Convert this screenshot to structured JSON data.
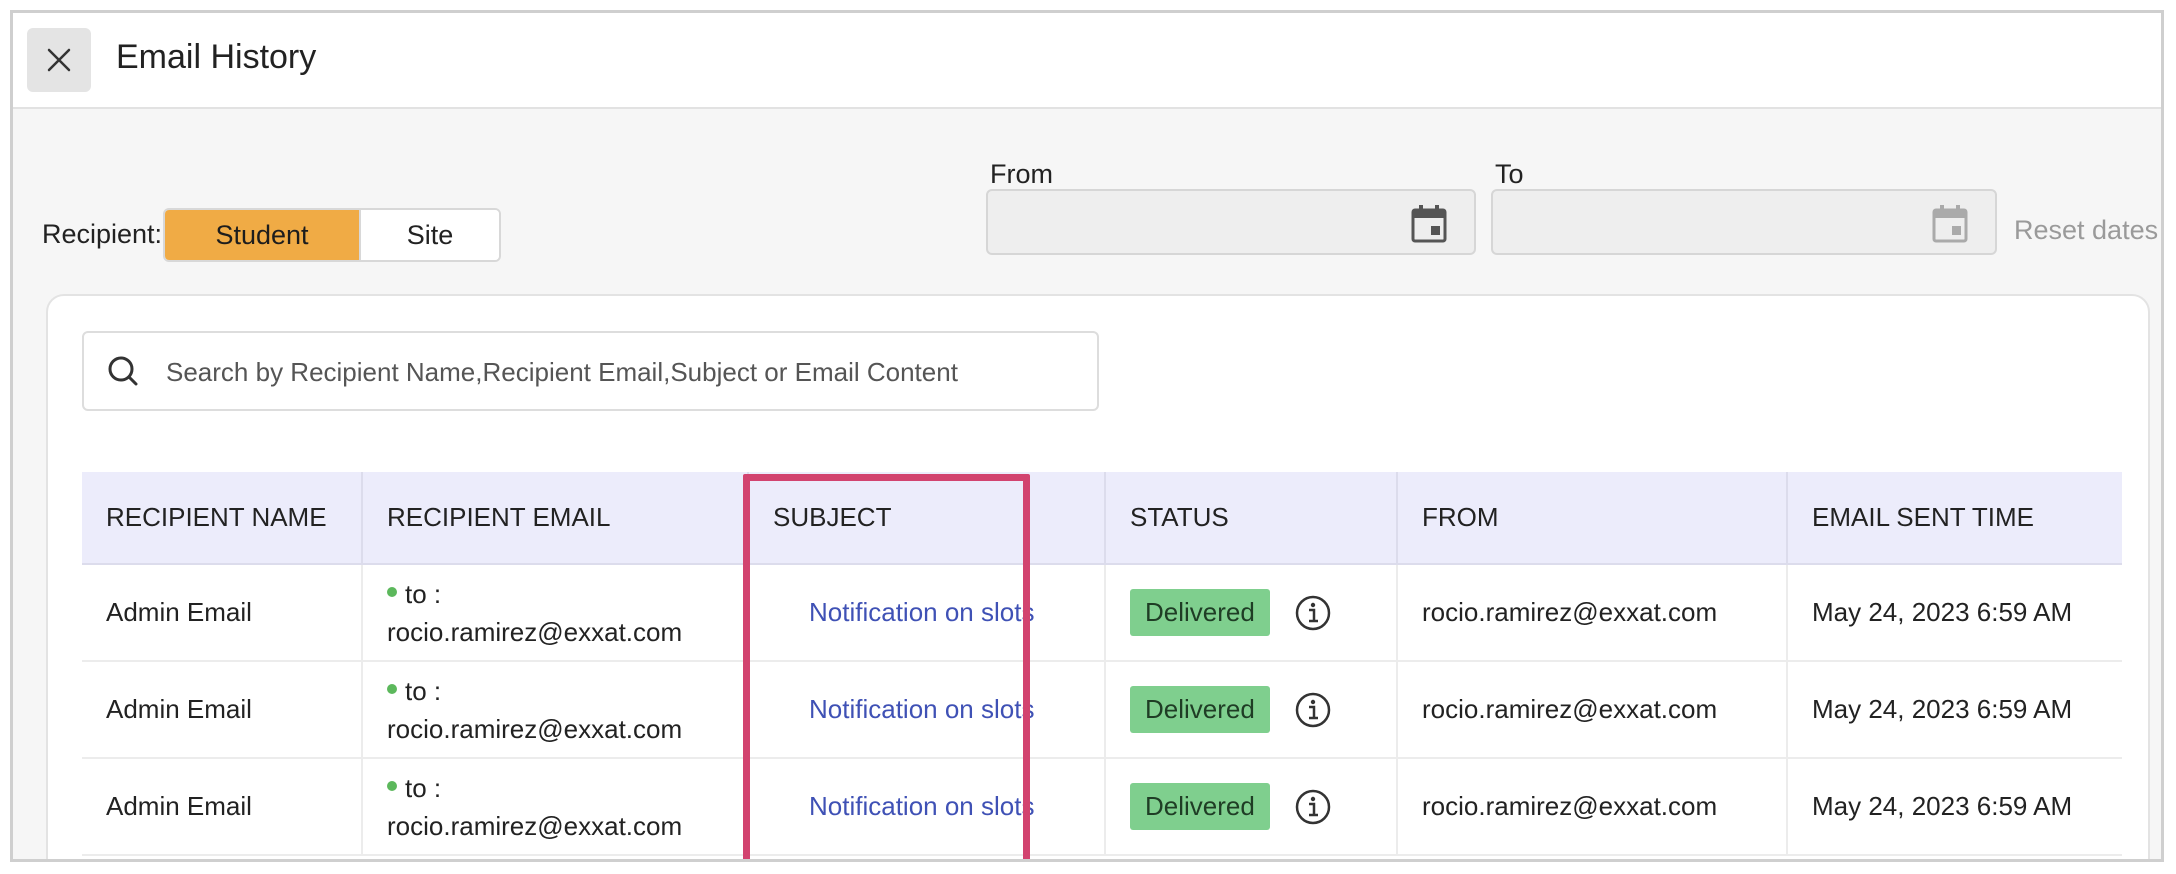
{
  "header": {
    "title": "Email History"
  },
  "filters": {
    "recipient_label": "Recipient:",
    "recipient_options": [
      {
        "label": "Student",
        "selected": true
      },
      {
        "label": "Site",
        "selected": false
      }
    ],
    "from_label": "From",
    "to_label": "To",
    "from_value": "",
    "to_value": "",
    "reset_label": "Reset dates"
  },
  "search": {
    "placeholder": "Search by Recipient Name,Recipient Email,Subject or Email Content",
    "value": ""
  },
  "table": {
    "columns": [
      "RECIPIENT NAME",
      "RECIPIENT EMAIL",
      "SUBJECT",
      "STATUS",
      "FROM",
      "EMAIL SENT TIME"
    ],
    "rows": [
      {
        "recipient_name": "Admin Email",
        "to_label": "to :",
        "recipient_email": "rocio.ramirez@exxat.com",
        "subject": "Notification on slots",
        "status": "Delivered",
        "from": "rocio.ramirez@exxat.com",
        "sent_time": "May 24, 2023 6:59 AM"
      },
      {
        "recipient_name": "Admin Email",
        "to_label": "to :",
        "recipient_email": "rocio.ramirez@exxat.com",
        "subject": "Notification on slots",
        "status": "Delivered",
        "from": "rocio.ramirez@exxat.com",
        "sent_time": "May 24, 2023 6:59 AM"
      },
      {
        "recipient_name": "Admin Email",
        "to_label": "to :",
        "recipient_email": "rocio.ramirez@exxat.com",
        "subject": "Notification on slots",
        "status": "Delivered",
        "from": "rocio.ramirez@exxat.com",
        "sent_time": "May 24, 2023 6:59 AM"
      }
    ]
  },
  "colors": {
    "accent": "#f0ab45",
    "header_bg": "#ececfb",
    "link": "#3f51b5",
    "status_delivered": "#7fcf8e",
    "highlight": "#d2436f"
  },
  "icons": {
    "close": "close-icon",
    "calendar": "calendar-icon",
    "search": "search-icon",
    "info": "info-icon"
  }
}
